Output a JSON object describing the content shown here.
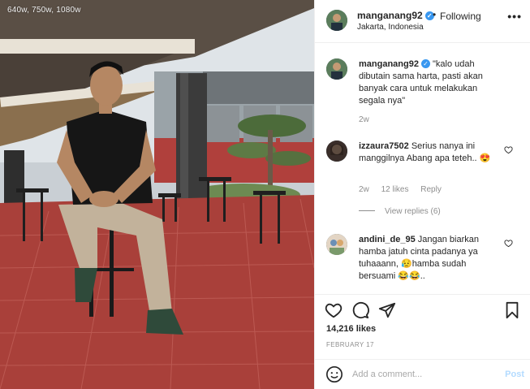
{
  "photo": {
    "caption": "640w, 750w, 1080w",
    "alt_subject": "man seated on bar stool on red tiled terrace"
  },
  "header": {
    "username": "manganang92",
    "verified": true,
    "separator": "•",
    "follow_status": "Following",
    "location": "Jakarta, Indonesia",
    "more_icon": "more-horizontal-icon"
  },
  "comments": [
    {
      "username": "manganang92",
      "verified": true,
      "text": "\"kalo udah dibutain sama harta, pasti akan banyak cara untuk melakukan segala nya\"",
      "time": "2w",
      "likes": "",
      "reply": ""
    },
    {
      "username": "izzaura7502",
      "verified": false,
      "text": "Serius nanya ini manggilnya Abang apa teteh.. 😍",
      "time": "2w",
      "likes": "12 likes",
      "reply": "Reply",
      "view_replies": "View replies (6)"
    },
    {
      "username": "andini_de_95",
      "verified": false,
      "text": "Jangan biarkan hamba jatuh cinta padanya ya tuhaaann, 😥hamba sudah bersuami 😂😂..",
      "time": "",
      "likes": "",
      "reply": ""
    }
  ],
  "actions": {
    "like_icon": "heart-icon",
    "comment_icon": "comment-icon",
    "share_icon": "share-icon",
    "save_icon": "bookmark-icon",
    "likes_count": "14,216 likes",
    "date": "FEBRUARY 17"
  },
  "add_comment": {
    "placeholder": "Add a comment...",
    "post_label": "Post"
  },
  "colors": {
    "verified_blue": "#3897f0",
    "muted_text": "#8e8e8e",
    "post_disabled": "#b3dbff"
  }
}
